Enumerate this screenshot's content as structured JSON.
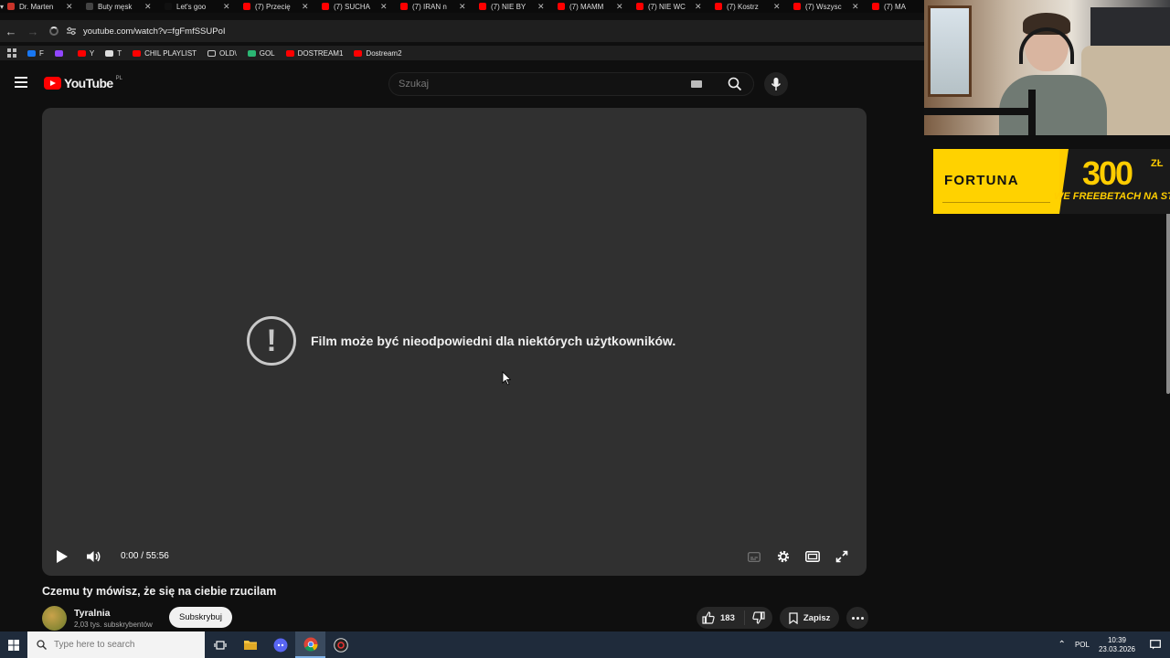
{
  "browser": {
    "tabs": [
      {
        "label": "Dr. Marten",
        "color": "#c9342a"
      },
      {
        "label": "Buty męsk",
        "color": "#444444"
      },
      {
        "label": "Let's goo",
        "color": "#111111"
      },
      {
        "label": "(7) Przecię",
        "color": "#ff0000"
      },
      {
        "label": "(7) SUCHA",
        "color": "#ff0000"
      },
      {
        "label": "(7) IRAN n",
        "color": "#ff0000"
      },
      {
        "label": "(7) NIE BY",
        "color": "#ff0000"
      },
      {
        "label": "(7) MAMM",
        "color": "#ff0000"
      },
      {
        "label": "(7) NIE WC",
        "color": "#ff0000"
      },
      {
        "label": "(7) Kostrz",
        "color": "#ff0000"
      },
      {
        "label": "(7) Wszysc",
        "color": "#ff0000"
      },
      {
        "label": "(7) MA",
        "color": "#ff0000"
      }
    ],
    "url": "youtube.com/watch?v=fgFmfSSUPoI",
    "bookmarks": [
      {
        "label": "F",
        "icon": "facebook-icon",
        "color": "#1877f2"
      },
      {
        "label": "",
        "icon": "twitch-icon",
        "color": "#9146ff"
      },
      {
        "label": "Y",
        "icon": "youtube-icon",
        "color": "#ff0000"
      },
      {
        "label": "T",
        "icon": "x-icon",
        "color": "#dddddd"
      },
      {
        "label": "CHIL PLAYLIST",
        "icon": "youtube-icon",
        "color": "#ff0000"
      },
      {
        "label": "OLD\\",
        "icon": "folder-icon",
        "color": "#cccccc"
      },
      {
        "label": "GOL",
        "icon": "gol-icon",
        "color": "#2bb673"
      },
      {
        "label": "DOSTREAM1",
        "icon": "youtube-icon",
        "color": "#ff0000"
      },
      {
        "label": "Dostream2",
        "icon": "youtube-icon",
        "color": "#ff0000"
      }
    ]
  },
  "youtube": {
    "logo_text": "YouTube",
    "logo_country": "PL",
    "search_placeholder": "Szukaj",
    "player": {
      "warning_text": "Film może być nieodpowiedni dla niektórych użytkowników.",
      "time": "0:00 / 55:56"
    },
    "video": {
      "title": "Czemu ty mówisz, że się na ciebie rzucilam",
      "channel_name": "Tyralnia",
      "channel_subs": "2,03 tys. subskrybentów",
      "subscribe_label": "Subskrybuj",
      "like_count": "183",
      "save_label": "Zapisz"
    }
  },
  "ad": {
    "brand": "FORTUNA",
    "amount": "300",
    "currency": "ZŁ",
    "tagline": "WE FREEBETACH NA STAR"
  },
  "taskbar": {
    "search_placeholder": "Type here to search",
    "language": "POL",
    "time": "10:39",
    "date": "23.03.2026"
  },
  "colors": {
    "youtube_red": "#ff0000",
    "player_bg": "#303030",
    "page_bg": "#0f0f0f",
    "fortuna_yellow": "#ffcd00",
    "taskbar_bg": "#1f2b3b"
  }
}
